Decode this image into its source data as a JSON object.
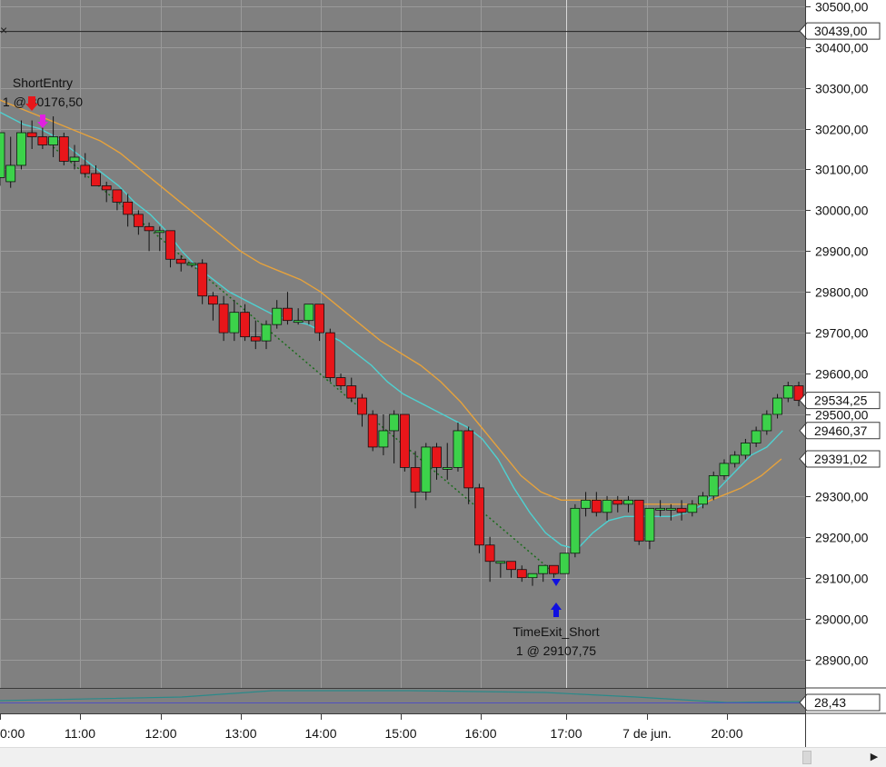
{
  "chart_data": {
    "type": "candlestick",
    "price_axis": {
      "ylim": [
        28830,
        30515
      ],
      "tick_labels": [
        "30500,00",
        "30400,00",
        "30300,00",
        "30200,00",
        "30100,00",
        "30000,00",
        "29900,00",
        "29800,00",
        "29700,00",
        "29600,00",
        "29500,00",
        "29300,00",
        "29200,00",
        "29100,00",
        "29000,00",
        "28900,00"
      ],
      "tick_values": [
        30500,
        30400,
        30300,
        30200,
        30100,
        30000,
        29900,
        29800,
        29700,
        29600,
        29500,
        29300,
        29200,
        29100,
        29000,
        28900
      ]
    },
    "time_axis": {
      "labels": [
        "0:00",
        "11:00",
        "12:00",
        "13:00",
        "14:00",
        "15:00",
        "16:00",
        "17:00",
        "7 de jun.",
        "20:00"
      ]
    },
    "candles": [
      {
        "o": 30080,
        "h": 30140,
        "l": 30060,
        "c": 30190
      },
      {
        "o": 30070,
        "h": 30180,
        "l": 30055,
        "c": 30110
      },
      {
        "o": 30110,
        "h": 30220,
        "l": 30100,
        "c": 30190
      },
      {
        "o": 30190,
        "h": 30220,
        "l": 30150,
        "c": 30180
      },
      {
        "o": 30180,
        "h": 30230,
        "l": 30150,
        "c": 30160
      },
      {
        "o": 30160,
        "h": 30230,
        "l": 30130,
        "c": 30180
      },
      {
        "o": 30180,
        "h": 30190,
        "l": 30110,
        "c": 30120
      },
      {
        "o": 30120,
        "h": 30160,
        "l": 30100,
        "c": 30130
      },
      {
        "o": 30110,
        "h": 30140,
        "l": 30080,
        "c": 30090
      },
      {
        "o": 30090,
        "h": 30110,
        "l": 30060,
        "c": 30060
      },
      {
        "o": 30060,
        "h": 30070,
        "l": 30020,
        "c": 30050
      },
      {
        "o": 30050,
        "h": 30050,
        "l": 30000,
        "c": 30020
      },
      {
        "o": 30020,
        "h": 30040,
        "l": 29960,
        "c": 29990
      },
      {
        "o": 29990,
        "h": 30000,
        "l": 29940,
        "c": 29960
      },
      {
        "o": 29960,
        "h": 29970,
        "l": 29900,
        "c": 29950
      },
      {
        "o": 29950,
        "h": 29960,
        "l": 29900,
        "c": 29950
      },
      {
        "o": 29950,
        "h": 29950,
        "l": 29860,
        "c": 29880
      },
      {
        "o": 29880,
        "h": 29890,
        "l": 29850,
        "c": 29870
      },
      {
        "o": 29870,
        "h": 29870,
        "l": 29860,
        "c": 29870
      },
      {
        "o": 29870,
        "h": 29880,
        "l": 29770,
        "c": 29790
      },
      {
        "o": 29790,
        "h": 29800,
        "l": 29730,
        "c": 29770
      },
      {
        "o": 29770,
        "h": 29790,
        "l": 29680,
        "c": 29700
      },
      {
        "o": 29700,
        "h": 29780,
        "l": 29680,
        "c": 29750
      },
      {
        "o": 29750,
        "h": 29770,
        "l": 29680,
        "c": 29690
      },
      {
        "o": 29690,
        "h": 29730,
        "l": 29660,
        "c": 29680
      },
      {
        "o": 29680,
        "h": 29730,
        "l": 29660,
        "c": 29720
      },
      {
        "o": 29720,
        "h": 29780,
        "l": 29710,
        "c": 29760
      },
      {
        "o": 29760,
        "h": 29800,
        "l": 29720,
        "c": 29730
      },
      {
        "o": 29730,
        "h": 29760,
        "l": 29720,
        "c": 29730
      },
      {
        "o": 29730,
        "h": 29770,
        "l": 29720,
        "c": 29770
      },
      {
        "o": 29770,
        "h": 29770,
        "l": 29680,
        "c": 29700
      },
      {
        "o": 29700,
        "h": 29710,
        "l": 29580,
        "c": 29590
      },
      {
        "o": 29590,
        "h": 29600,
        "l": 29560,
        "c": 29570
      },
      {
        "o": 29570,
        "h": 29590,
        "l": 29530,
        "c": 29540
      },
      {
        "o": 29540,
        "h": 29550,
        "l": 29470,
        "c": 29500
      },
      {
        "o": 29500,
        "h": 29510,
        "l": 29410,
        "c": 29420
      },
      {
        "o": 29420,
        "h": 29500,
        "l": 29400,
        "c": 29460
      },
      {
        "o": 29460,
        "h": 29510,
        "l": 29380,
        "c": 29500
      },
      {
        "o": 29500,
        "h": 29500,
        "l": 29360,
        "c": 29370
      },
      {
        "o": 29370,
        "h": 29410,
        "l": 29270,
        "c": 29310
      },
      {
        "o": 29310,
        "h": 29430,
        "l": 29290,
        "c": 29420
      },
      {
        "o": 29420,
        "h": 29430,
        "l": 29340,
        "c": 29370
      },
      {
        "o": 29370,
        "h": 29430,
        "l": 29340,
        "c": 29370
      },
      {
        "o": 29370,
        "h": 29480,
        "l": 29360,
        "c": 29460
      },
      {
        "o": 29460,
        "h": 29470,
        "l": 29280,
        "c": 29320
      },
      {
        "o": 29320,
        "h": 29330,
        "l": 29160,
        "c": 29180
      },
      {
        "o": 29180,
        "h": 29200,
        "l": 29090,
        "c": 29140
      },
      {
        "o": 29140,
        "h": 29140,
        "l": 29100,
        "c": 29140
      },
      {
        "o": 29140,
        "h": 29140,
        "l": 29100,
        "c": 29120
      },
      {
        "o": 29120,
        "h": 29130,
        "l": 29090,
        "c": 29100
      },
      {
        "o": 29100,
        "h": 29110,
        "l": 29080,
        "c": 29110
      },
      {
        "o": 29110,
        "h": 29130,
        "l": 29090,
        "c": 29130
      },
      {
        "o": 29130,
        "h": 29130,
        "l": 29100,
        "c": 29110
      },
      {
        "o": 29110,
        "h": 29160,
        "l": 29110,
        "c": 29160
      },
      {
        "o": 29160,
        "h": 29280,
        "l": 29150,
        "c": 29270
      },
      {
        "o": 29270,
        "h": 29310,
        "l": 29250,
        "c": 29290
      },
      {
        "o": 29290,
        "h": 29310,
        "l": 29250,
        "c": 29260
      },
      {
        "o": 29260,
        "h": 29300,
        "l": 29240,
        "c": 29290
      },
      {
        "o": 29290,
        "h": 29300,
        "l": 29260,
        "c": 29280
      },
      {
        "o": 29280,
        "h": 29300,
        "l": 29260,
        "c": 29290
      },
      {
        "o": 29290,
        "h": 29290,
        "l": 29180,
        "c": 29190
      },
      {
        "o": 29190,
        "h": 29230,
        "l": 29170,
        "c": 29270
      },
      {
        "o": 29270,
        "h": 29290,
        "l": 29250,
        "c": 29270
      },
      {
        "o": 29270,
        "h": 29280,
        "l": 29240,
        "c": 29270
      },
      {
        "o": 29270,
        "h": 29290,
        "l": 29240,
        "c": 29260
      },
      {
        "o": 29260,
        "h": 29290,
        "l": 29250,
        "c": 29280
      },
      {
        "o": 29280,
        "h": 29310,
        "l": 29270,
        "c": 29300
      },
      {
        "o": 29300,
        "h": 29360,
        "l": 29290,
        "c": 29350
      },
      {
        "o": 29350,
        "h": 29390,
        "l": 29340,
        "c": 29380
      },
      {
        "o": 29380,
        "h": 29410,
        "l": 29370,
        "c": 29400
      },
      {
        "o": 29400,
        "h": 29440,
        "l": 29390,
        "c": 29430
      },
      {
        "o": 29430,
        "h": 29470,
        "l": 29420,
        "c": 29460
      },
      {
        "o": 29460,
        "h": 29510,
        "l": 29450,
        "c": 29500
      },
      {
        "o": 29500,
        "h": 29550,
        "l": 29490,
        "c": 29540
      },
      {
        "o": 29540,
        "h": 29580,
        "l": 29530,
        "c": 29570
      },
      {
        "o": 29570,
        "h": 29580,
        "l": 29520,
        "c": 29534.25
      }
    ],
    "series": [
      {
        "color": "#4ed1d1",
        "last": 29460.37,
        "values": [
          30240,
          30210,
          30200,
          30180,
          30150,
          30120,
          30090,
          30060,
          30020,
          29990,
          29950,
          29900,
          29860,
          29830,
          29800,
          29780,
          29760,
          29740,
          29730,
          29720,
          29700,
          29680,
          29650,
          29620,
          29580,
          29550,
          29530,
          29510,
          29490,
          29470,
          29440,
          29390,
          29320,
          29260,
          29210,
          29180,
          29170,
          29210,
          29240,
          29250,
          29250,
          29250,
          29250,
          29260,
          29280,
          29320,
          29360,
          29400,
          29420,
          29460.37
        ],
        "x": [
          0,
          3,
          5,
          7,
          9,
          11,
          13,
          15,
          17,
          19,
          21,
          23,
          25,
          27,
          29,
          31,
          33,
          35,
          37,
          39,
          41,
          43,
          45,
          47,
          49,
          51,
          53,
          55,
          57,
          59,
          61,
          63,
          65,
          67,
          69,
          71,
          73,
          75,
          77,
          79,
          81,
          83,
          85,
          87,
          89,
          91,
          93,
          95,
          97,
          99
        ]
      },
      {
        "color": "#e6a23c",
        "last": 29391.02,
        "values": [
          30270,
          30250,
          30230,
          30210,
          30190,
          30170,
          30140,
          30100,
          30060,
          30020,
          29980,
          29940,
          29900,
          29870,
          29850,
          29830,
          29800,
          29760,
          29720,
          29680,
          29650,
          29620,
          29580,
          29530,
          29470,
          29410,
          29350,
          29310,
          29290,
          29290,
          29290,
          29290,
          29280,
          29280,
          29280,
          29280,
          29300,
          29320,
          29350,
          29391.02
        ],
        "x": [
          0,
          3,
          6,
          9,
          12,
          15,
          18,
          21,
          24,
          27,
          30,
          33,
          36,
          39,
          42,
          45,
          48,
          51,
          54,
          57,
          60,
          63,
          66,
          69,
          72,
          75,
          78,
          81,
          84,
          87,
          90,
          93,
          96,
          99,
          102,
          105,
          108,
          111,
          114,
          117
        ]
      }
    ],
    "price_markers": [
      {
        "label": "30439,00",
        "value": 30439,
        "type": "line"
      },
      {
        "label": "29534,25",
        "value": 29534.25,
        "type": "last"
      },
      {
        "label": "29460,37",
        "value": 29460.37,
        "type": "ma_fast"
      },
      {
        "label": "29391,02",
        "value": 29391.02,
        "type": "ma_slow"
      }
    ],
    "trades": {
      "entry": {
        "name": "ShortEntry",
        "label": "1 @ 30176,50",
        "value": 30176.5,
        "text_line2": "1 @ 30176,50"
      },
      "exit": {
        "name": "TimeExit_Short",
        "label": "1 @ 29107,75",
        "value": 29107.75
      }
    },
    "indicator_panel": {
      "marker_label": "28,43",
      "value": 28.43
    },
    "grid": true,
    "background": "#808080",
    "colors": {
      "up": "#3cd24a",
      "down": "#e8161a",
      "grid": "#9a9a9a",
      "axis_bg": "#ffffff"
    }
  }
}
